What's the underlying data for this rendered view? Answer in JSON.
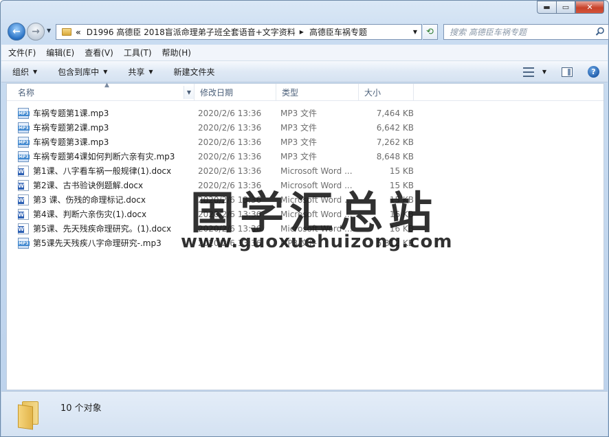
{
  "window": {
    "minimize_glyph": "▬",
    "maximize_glyph": "▭",
    "close_glyph": "✕"
  },
  "nav": {
    "back_glyph": "←",
    "forward_glyph": "→",
    "address": {
      "chevron": "«",
      "segments": [
        "D1996 高德臣 2018盲派命理弟子班全套语音+文字资料",
        "高德臣车祸专题"
      ]
    },
    "search_placeholder": "搜索 高德臣车祸专题"
  },
  "menu": [
    "文件(F)",
    "编辑(E)",
    "查看(V)",
    "工具(T)",
    "帮助(H)"
  ],
  "toolbar": {
    "organize": "组织",
    "include_in_library": "包含到库中",
    "share": "共享",
    "new_folder": "新建文件夹"
  },
  "columns": {
    "name": "名称",
    "date": "修改日期",
    "type": "类型",
    "size": "大小"
  },
  "files": [
    {
      "icon": "mp3",
      "name": "车祸专题第1课.mp3",
      "date": "2020/2/6 13:36",
      "type": "MP3 文件",
      "size": "7,464 KB"
    },
    {
      "icon": "mp3",
      "name": "车祸专题第2课.mp3",
      "date": "2020/2/6 13:36",
      "type": "MP3 文件",
      "size": "6,642 KB"
    },
    {
      "icon": "mp3",
      "name": "车祸专题第3课.mp3",
      "date": "2020/2/6 13:36",
      "type": "MP3 文件",
      "size": "7,262 KB"
    },
    {
      "icon": "mp3",
      "name": "车祸专题第4课如何判断六亲有灾.mp3",
      "date": "2020/2/6 13:36",
      "type": "MP3 文件",
      "size": "8,648 KB"
    },
    {
      "icon": "docx",
      "name": "第1课、八字看车祸一般规律(1).docx",
      "date": "2020/2/6 13:36",
      "type": "Microsoft Word ...",
      "size": "15 KB"
    },
    {
      "icon": "docx",
      "name": "第2课、古书验诀例题解.docx",
      "date": "2020/2/6 13:36",
      "type": "Microsoft Word ...",
      "size": "15 KB"
    },
    {
      "icon": "docx",
      "name": "第3 课、伤残的命理标记.docx",
      "date": "2020/2/6 13:36",
      "type": "Microsoft Word ...",
      "size": "15 KB"
    },
    {
      "icon": "docx",
      "name": "第4课、判断六亲伤灾(1).docx",
      "date": "2020/2/6 13:36",
      "type": "Microsoft Word ...",
      "size": "16 KB"
    },
    {
      "icon": "docx",
      "name": "第5课、先天残疾命理研究。(1).docx",
      "date": "2020/2/6 13:36",
      "type": "Microsoft Word ...",
      "size": "16 KB"
    },
    {
      "icon": "mp3",
      "name": "第5课先天残疾八字命理研究-.mp3",
      "date": "2020/2/6 13:36",
      "type": "MP3 文件",
      "size": "5,312 KB"
    }
  ],
  "watermark": {
    "title": "国学汇总站",
    "url": "www.guoxuehuizong.com"
  },
  "status": {
    "count_text": "10 个对象"
  }
}
